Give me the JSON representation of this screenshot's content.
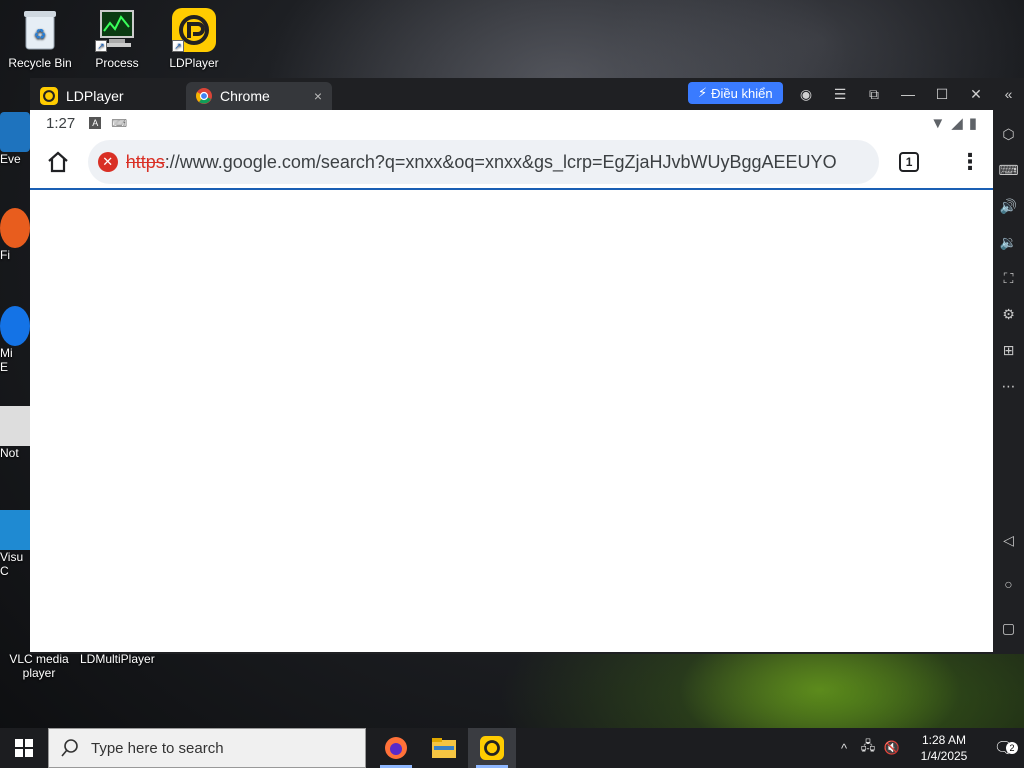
{
  "desktop": {
    "icons_top": [
      {
        "label": "Recycle Bin",
        "icon": "recycle-bin-icon"
      },
      {
        "label": "Process",
        "icon": "process-icon"
      },
      {
        "label": "LDPlayer",
        "icon": "ldplayer-icon"
      }
    ],
    "left_partial": [
      "Eve",
      "Fi",
      "Mi\nE",
      "Not",
      "Visu\nC"
    ],
    "vlc_label": "VLC media player",
    "ldmulti_label": "LDMultiPlayer"
  },
  "ldplayer": {
    "tab_home": "LDPlayer",
    "tab_chrome": "Chrome",
    "tab_close": "×",
    "control_button": "Điều khiển",
    "win_controls": [
      "account-icon",
      "menu-icon",
      "restore-icon",
      "minimize-icon",
      "maximize-icon",
      "close-icon",
      "collapse-icon"
    ],
    "sidebar_icons": [
      "settings-icon",
      "keyboard-icon",
      "volume-up-icon",
      "volume-down-icon",
      "screenshot-icon",
      "install-apk-icon",
      "add-instance-icon",
      "more-icon",
      "back-icon",
      "home-icon",
      "recents-icon"
    ]
  },
  "android": {
    "time": "1:27",
    "status_icons": [
      "notification-a-icon",
      "keyboard-icon"
    ],
    "tab_count": "1",
    "url_scheme": "https",
    "url_rest": "://www.google.com/search?q=xnxx&oq=xnxx&gs_lcrp=EgZjaHJvbWUyBggAEEUYO"
  },
  "taskbar": {
    "search_placeholder": "Type here to search",
    "apps": [
      "firefox-icon",
      "file-explorer-icon",
      "ldplayer-icon"
    ],
    "time": "1:28 AM",
    "date": "1/4/2025",
    "notification_count": "2"
  },
  "colors": {
    "accent_blue": "#3a7bff",
    "error_red": "#d93025",
    "ld_dark": "#1f2023"
  }
}
